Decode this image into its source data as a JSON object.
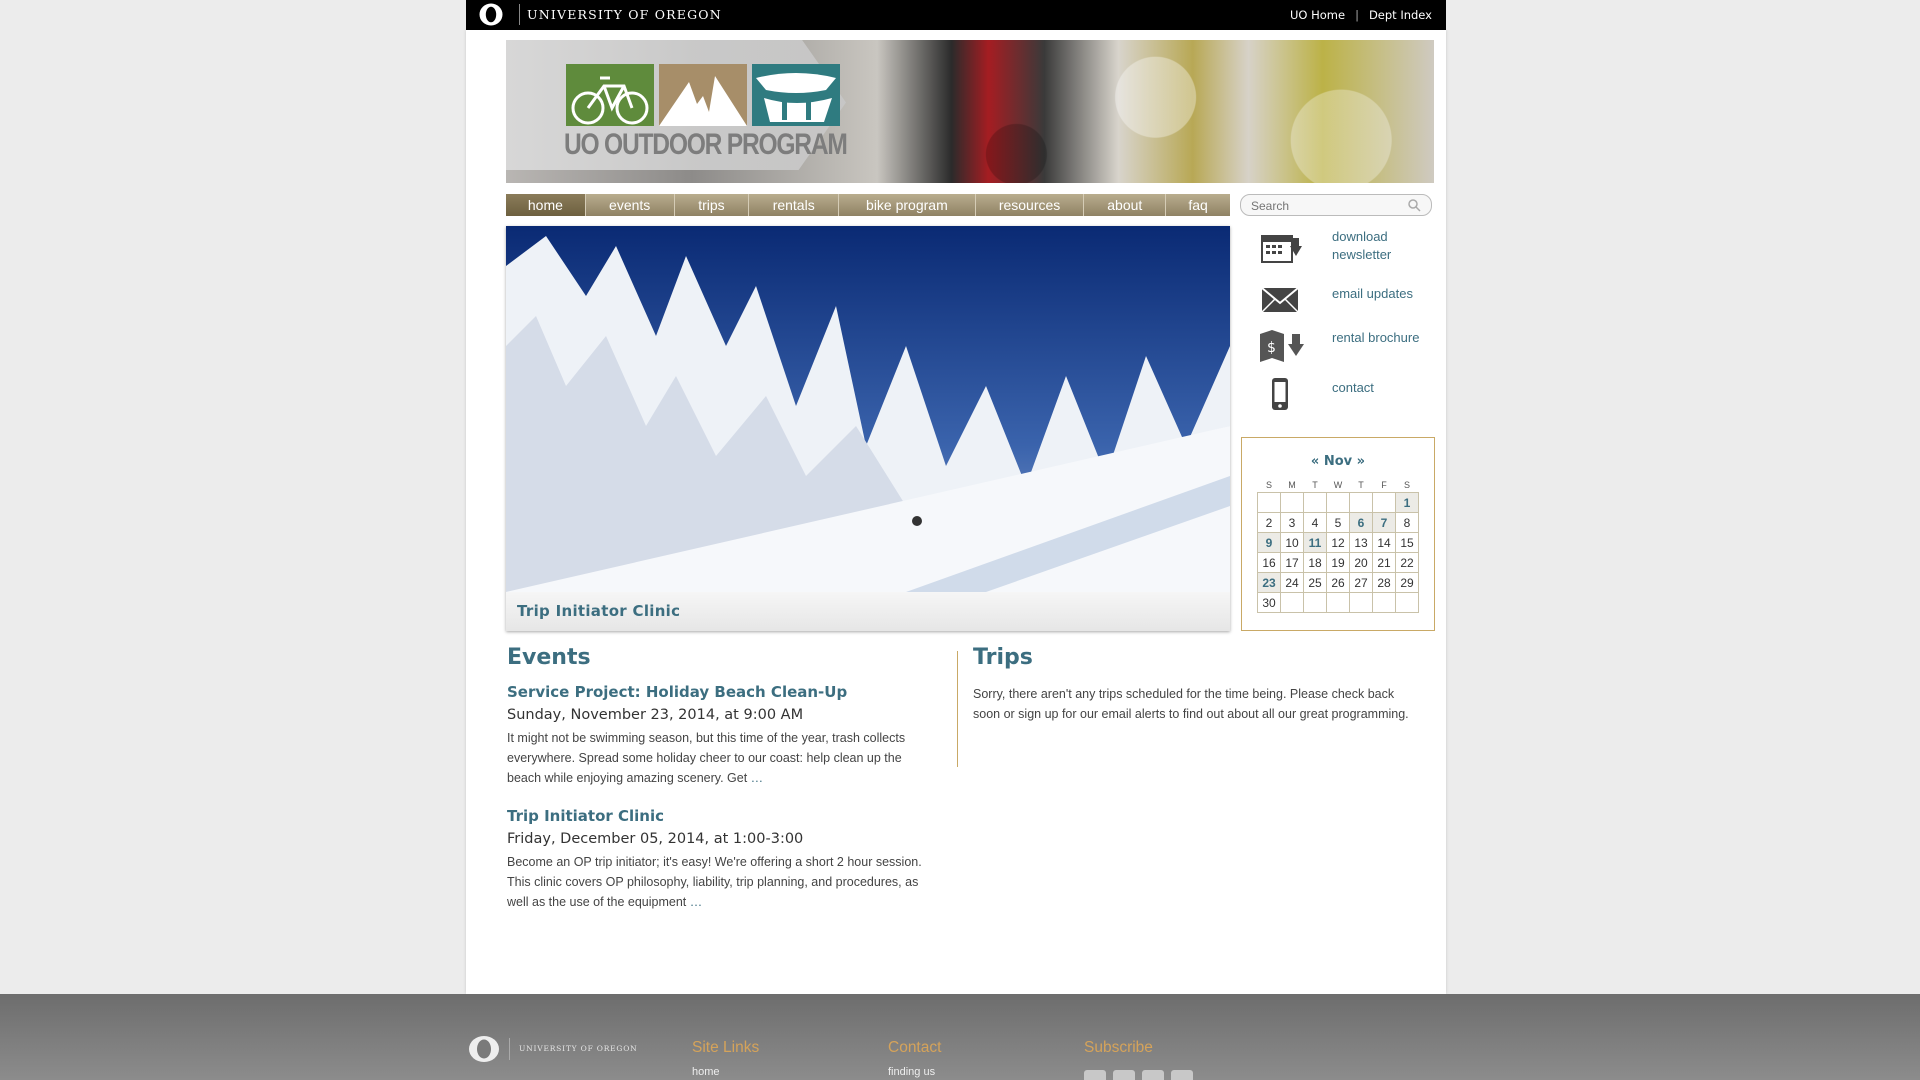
{
  "topbar": {
    "university_name": "UNIVERSITY OF OREGON",
    "links": [
      "UO Home",
      "Dept Index"
    ]
  },
  "header": {
    "logo_text": "UO OUTDOOR PROGRAM"
  },
  "nav": {
    "items": [
      "home",
      "events",
      "trips",
      "rentals",
      "bike program",
      "resources",
      "about",
      "faq"
    ],
    "active": "home"
  },
  "search": {
    "placeholder": "Search"
  },
  "slideshow": {
    "caption": "Trip Initiator Clinic"
  },
  "quick_links": [
    {
      "label": "download newsletter",
      "icon": "calendar-download-icon"
    },
    {
      "label": "email updates",
      "icon": "envelope-icon"
    },
    {
      "label": "rental brochure",
      "icon": "brochure-download-icon"
    },
    {
      "label": "contact",
      "icon": "mobile-phone-icon"
    }
  ],
  "calendar": {
    "prev": "«",
    "month": "Nov",
    "next": "»",
    "weekdays": [
      "S",
      "M",
      "T",
      "W",
      "T",
      "F",
      "S"
    ],
    "weeks": [
      [
        "",
        "",
        "",
        "",
        "",
        "",
        "1"
      ],
      [
        "2",
        "3",
        "4",
        "5",
        "6",
        "7",
        "8"
      ],
      [
        "9",
        "10",
        "11",
        "12",
        "13",
        "14",
        "15"
      ],
      [
        "16",
        "17",
        "18",
        "19",
        "20",
        "21",
        "22"
      ],
      [
        "23",
        "24",
        "25",
        "26",
        "27",
        "28",
        "29"
      ],
      [
        "30",
        "",
        "",
        "",
        "",
        "",
        ""
      ]
    ],
    "event_days": [
      "1",
      "6",
      "7",
      "9",
      "11",
      "23"
    ]
  },
  "events": {
    "heading": "Events",
    "items": [
      {
        "title": "Service Project: Holiday Beach Clean-Up",
        "date": "Sunday, November 23, 2014, at 9:00 AM",
        "description": "It might not be swimming season, but this time of the year, trash collects everywhere. Spread some holiday cheer to our coast: help clean up the beach while enjoying amazing scenery. Get",
        "more": "…"
      },
      {
        "title": "Trip Initiator Clinic",
        "date": "Friday, December 05, 2014, at 1:00-3:00",
        "description": "Become an OP trip initiator; it's easy! We're offering a short 2 hour session. This clinic covers OP philosophy, liability, trip planning, and procedures, as well as the use of the equipment",
        "more": "…"
      }
    ]
  },
  "trips": {
    "heading": "Trips",
    "text": "Sorry, there aren't any trips scheduled for the time being. Please check back soon or sign up for our email alerts to find out about all our great programming."
  },
  "footer": {
    "logo_text": "UNIVERSITY OF OREGON",
    "columns": [
      {
        "heading": "Site Links",
        "first_link": "home"
      },
      {
        "heading": "Contact",
        "first_link": "finding us"
      },
      {
        "heading": "Subscribe",
        "first_link": ""
      }
    ]
  },
  "colors": {
    "accent": "#3c6e80",
    "nav": "#9e9274",
    "calendar_border": "#c9a966",
    "footer_heading": "#d5a35a"
  }
}
